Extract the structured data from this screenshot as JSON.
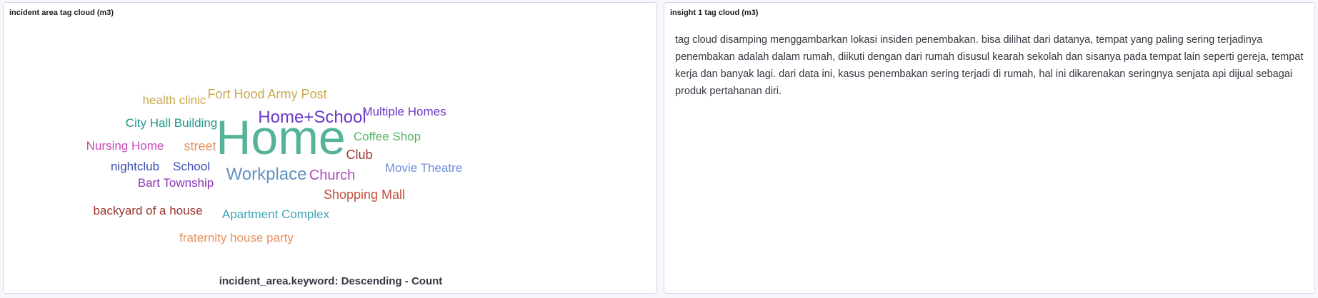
{
  "panels": {
    "left": {
      "title": "incident area tag cloud (m3)"
    },
    "right": {
      "title": "insight 1 tag cloud (m3)",
      "text": "tag cloud disamping menggambarkan lokasi insiden penembakan. bisa dilihat dari datanya, tempat yang paling sering terjadinya penembakan adalah dalam rumah, diikuti dengan dari rumah disusul kearah sekolah dan sisanya pada tempat lain seperti gereja, tempat kerja dan banyak lagi. dari data ini, kasus penembakan sering terjadi di rumah, hal ini dikarenakan seringnya senjata api dijual sebagai produk pertahanan diri."
    }
  },
  "chart_data": {
    "type": "tagcloud",
    "label": "incident_area.keyword: Descending - Count",
    "words": [
      {
        "text": "Home",
        "weight": 10,
        "color": "#54b399"
      },
      {
        "text": "Workplace",
        "weight": 3,
        "color": "#6092c0"
      },
      {
        "text": "Home+School",
        "weight": 3,
        "color": "#6c39c6"
      },
      {
        "text": "Church",
        "weight": 2,
        "color": "#b24bbf"
      },
      {
        "text": "Club",
        "weight": 2,
        "color": "#9a3531"
      },
      {
        "text": "Shopping Mall",
        "weight": 2,
        "color": "#c2503f"
      },
      {
        "text": "street",
        "weight": 2,
        "color": "#e7915f"
      },
      {
        "text": "Fort Hood Army Post",
        "weight": 2,
        "color": "#c9a94b"
      },
      {
        "text": "Apartment Complex",
        "weight": 2,
        "color": "#3ea7b8"
      },
      {
        "text": "City Hall Building",
        "weight": 2,
        "color": "#23958c"
      },
      {
        "text": "Multiple Homes",
        "weight": 2,
        "color": "#6c39c6"
      },
      {
        "text": "Coffee Shop",
        "weight": 2,
        "color": "#54b364"
      },
      {
        "text": "Movie Theatre",
        "weight": 2,
        "color": "#6e8fdb"
      },
      {
        "text": "Nursing Home",
        "weight": 2,
        "color": "#ca4ab4"
      },
      {
        "text": "School",
        "weight": 2,
        "color": "#3a4eb1"
      },
      {
        "text": "nightclub",
        "weight": 2,
        "color": "#3a4eb1"
      },
      {
        "text": "health clinic",
        "weight": 2,
        "color": "#c9a94b"
      },
      {
        "text": "Bart Township",
        "weight": 2,
        "color": "#8a36b4"
      },
      {
        "text": "backyard of a house",
        "weight": 2,
        "color": "#9a3531"
      },
      {
        "text": "fraternity house party",
        "weight": 2,
        "color": "#e7915f"
      }
    ]
  }
}
